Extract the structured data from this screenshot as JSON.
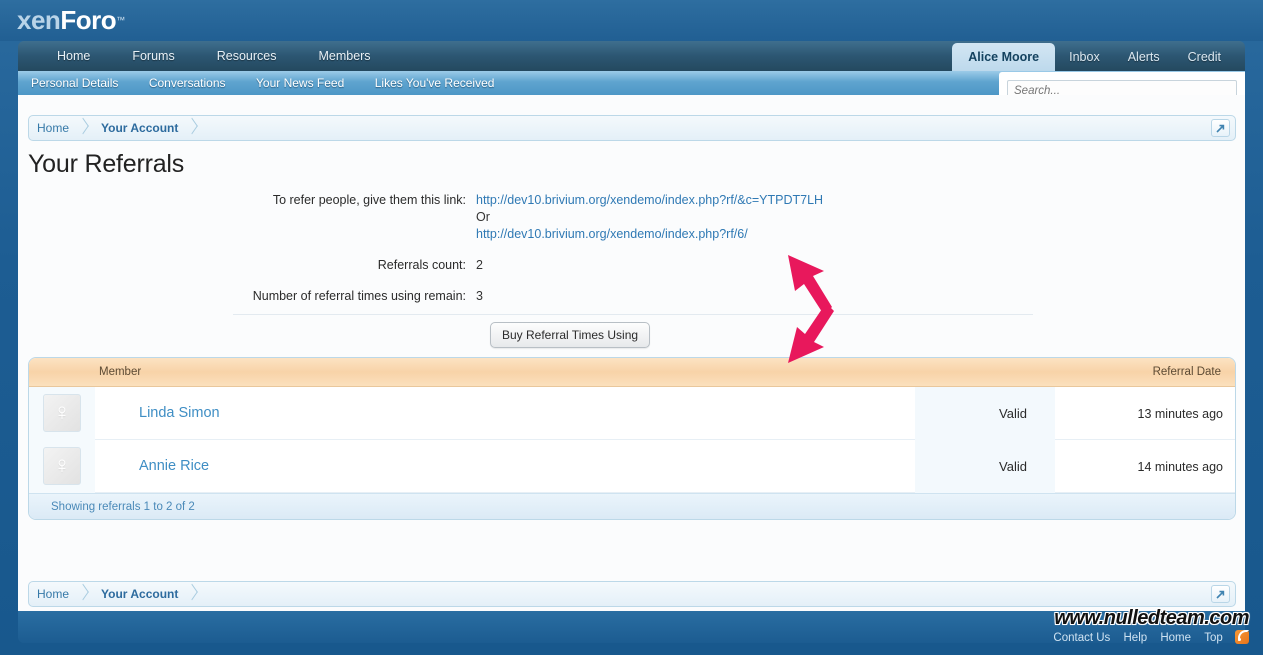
{
  "brand": {
    "logo_xen": "xen",
    "logo_foro": "Foro",
    "trademark": "™"
  },
  "nav": {
    "primary": [
      {
        "label": "Home"
      },
      {
        "label": "Forums"
      },
      {
        "label": "Resources"
      },
      {
        "label": "Members"
      }
    ],
    "account": [
      {
        "label": "Alice Moore",
        "selected": true
      },
      {
        "label": "Inbox",
        "selected": false
      },
      {
        "label": "Alerts",
        "selected": false
      },
      {
        "label": "Credit",
        "selected": false
      }
    ],
    "secondary": [
      {
        "label": "Personal Details"
      },
      {
        "label": "Conversations"
      },
      {
        "label": "Your News Feed"
      },
      {
        "label": "Likes You've Received"
      }
    ]
  },
  "search": {
    "placeholder": "Search...",
    "value": ""
  },
  "breadcrumb": {
    "items": [
      {
        "label": "Home"
      },
      {
        "label": "Your Account"
      }
    ],
    "jump_icon": "popup-arrow-icon"
  },
  "page": {
    "title": "Your Referrals"
  },
  "referral_info": {
    "link_label": "To refer people, give them this link:",
    "link_primary": "http://dev10.brivium.org/xendemo/index.php?rf/&c=YTPDT7LH",
    "or_text": "Or",
    "link_secondary": "http://dev10.brivium.org/xendemo/index.php?rf/6/",
    "count_label": "Referrals count:",
    "count_value": "2",
    "remain_label": "Number of referral times using remain:",
    "remain_value": "3",
    "buy_button": "Buy Referral Times Using"
  },
  "table": {
    "columns": {
      "member": "Member",
      "date": "Referral Date"
    },
    "rows": [
      {
        "avatar_icon": "female-avatar-icon",
        "avatar_glyph": "♀",
        "name": "Linda Simon",
        "status": "Valid",
        "date": "13 minutes ago"
      },
      {
        "avatar_icon": "female-avatar-icon",
        "avatar_glyph": "♀",
        "name": "Annie Rice",
        "status": "Valid",
        "date": "14 minutes ago"
      }
    ],
    "footer": "Showing referrals 1 to 2 of 2"
  },
  "footer": {
    "watermark": "www.nulledteam.com",
    "links": [
      {
        "label": "Contact Us"
      },
      {
        "label": "Help"
      },
      {
        "label": "Home"
      },
      {
        "label": "Top"
      }
    ],
    "rss_icon": "rss-feed-icon"
  },
  "annotations": {
    "arrow_color": "#e8185c",
    "arrows": [
      "arrow-up-left",
      "arrow-down-left"
    ]
  },
  "colors": {
    "brand_blue": "#2a6a9e",
    "nav_dark": "#2c5672",
    "subnav_blue": "#5fa4cf",
    "link_blue": "#2f79b4",
    "table_header_orange": "#f8d3a8",
    "accent_pink": "#e8185c"
  }
}
